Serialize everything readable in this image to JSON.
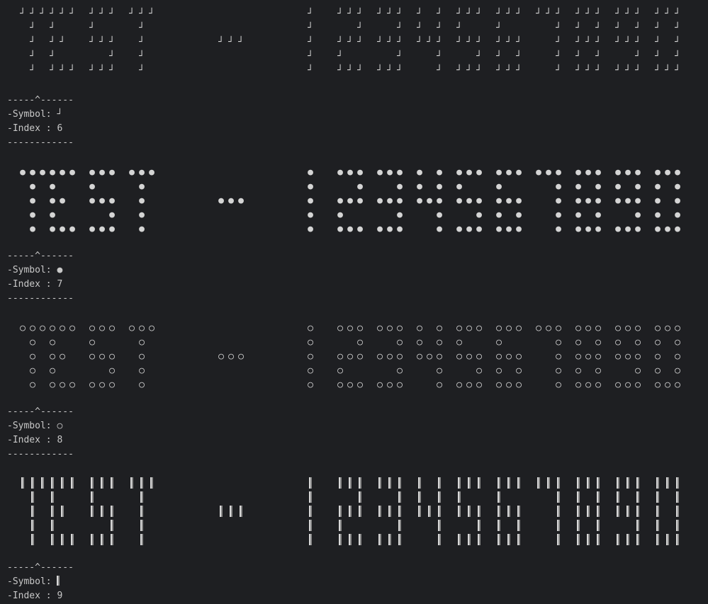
{
  "terminal": {
    "banner_text": "TEST . 12345 7890",
    "blocks": [
      {
        "glyph": "┘",
        "separator_top": "-----^------",
        "symbol_label": "-Symbol: ",
        "symbol_value": "┘",
        "index_label": "-Index : ",
        "index_value": "6",
        "separator_bottom": "------------"
      },
      {
        "glyph": "●",
        "separator_top": "-----^------",
        "symbol_label": "-Symbol: ",
        "symbol_value": "●",
        "index_label": "-Index : ",
        "index_value": "7",
        "separator_bottom": "------------"
      },
      {
        "glyph": "○",
        "separator_top": "-----^------",
        "symbol_label": "-Symbol: ",
        "symbol_value": "○",
        "index_label": "-Index : ",
        "index_value": "8",
        "separator_bottom": "------------"
      },
      {
        "glyph": "bar",
        "separator_top": "-----^------",
        "symbol_label": "-Symbol: ",
        "symbol_value": "",
        "index_label": "-Index : ",
        "index_value": "9",
        "separator_bottom": ""
      }
    ]
  }
}
